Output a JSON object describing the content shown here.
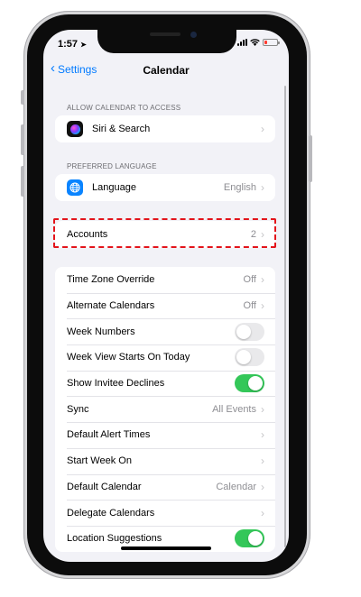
{
  "status_bar": {
    "time": "1:57"
  },
  "nav": {
    "back_label": "Settings",
    "title": "Calendar"
  },
  "sections": {
    "allow_access": {
      "header": "ALLOW CALENDAR TO ACCESS",
      "rows": [
        {
          "label": "Siri & Search",
          "icon": "siri-icon"
        }
      ]
    },
    "preferred_language": {
      "header": "PREFERRED LANGUAGE",
      "rows": [
        {
          "label": "Language",
          "value": "English",
          "icon": "globe-icon"
        }
      ]
    },
    "accounts": {
      "rows": [
        {
          "label": "Accounts",
          "value": "2"
        }
      ]
    },
    "settings": {
      "rows": [
        {
          "label": "Time Zone Override",
          "value": "Off",
          "type": "link"
        },
        {
          "label": "Alternate Calendars",
          "value": "Off",
          "type": "link"
        },
        {
          "label": "Week Numbers",
          "type": "toggle",
          "on": false
        },
        {
          "label": "Week View Starts On Today",
          "type": "toggle",
          "on": false
        },
        {
          "label": "Show Invitee Declines",
          "type": "toggle",
          "on": true
        },
        {
          "label": "Sync",
          "value": "All Events",
          "type": "link"
        },
        {
          "label": "Default Alert Times",
          "value": "",
          "type": "link"
        },
        {
          "label": "Start Week On",
          "value": "",
          "type": "link"
        },
        {
          "label": "Default Calendar",
          "value": "Calendar",
          "type": "link"
        },
        {
          "label": "Delegate Calendars",
          "value": "",
          "type": "link"
        },
        {
          "label": "Location Suggestions",
          "type": "toggle",
          "on": true
        }
      ]
    }
  },
  "colors": {
    "accent": "#007aff",
    "toggle_on": "#34c759",
    "highlight": "#e3141b",
    "background": "#f2f2f7"
  },
  "icons": {
    "back": "chevron-left-icon",
    "disclosure": "chevron-right-icon",
    "signal": "cellular-signal-icon",
    "wifi": "wifi-icon",
    "battery": "battery-icon",
    "location": "location-arrow-icon"
  }
}
